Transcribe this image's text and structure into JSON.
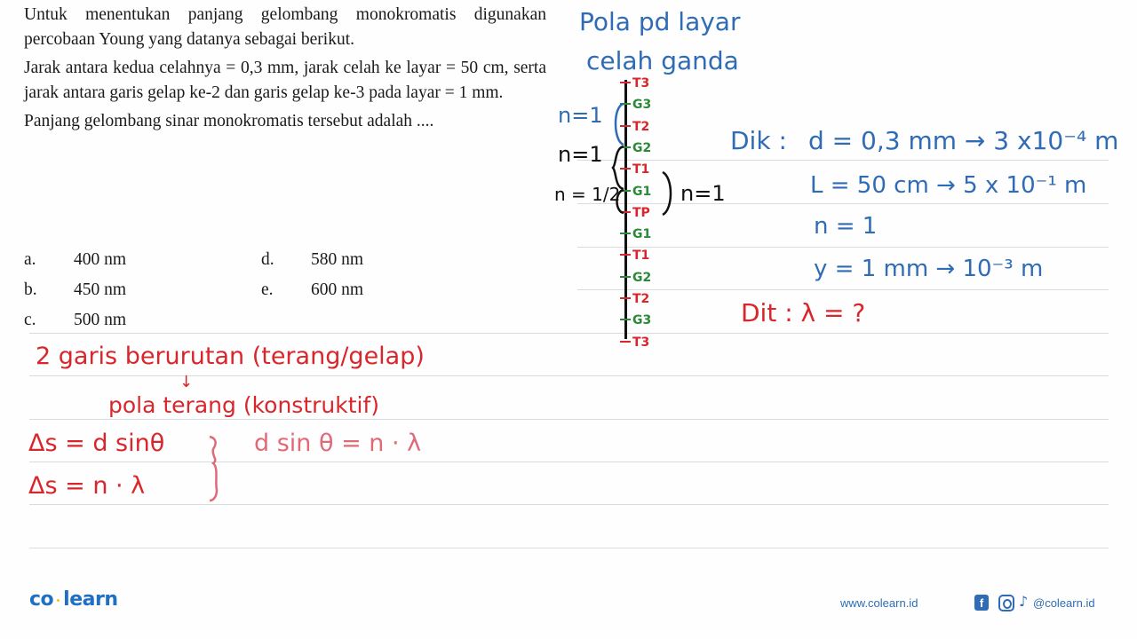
{
  "question": {
    "paragraph1": "Untuk menentukan panjang gelombang monokromatis digunakan percobaan Young yang datanya sebagai berikut.",
    "paragraph2": "Jarak antara kedua celahnya = 0,3 mm, jarak celah ke layar = 50 cm, serta jarak antara garis gelap ke-2 dan garis gelap ke-3 pada layar = 1 mm.",
    "paragraph3": "Panjang gelombang sinar monokromatis tersebut adalah ....",
    "options": [
      {
        "letter": "a.",
        "value": "400 nm"
      },
      {
        "letter": "b.",
        "value": "450 nm"
      },
      {
        "letter": "c.",
        "value": "500 nm"
      },
      {
        "letter": "d.",
        "value": "580 nm"
      },
      {
        "letter": "e.",
        "value": "600 nm"
      }
    ]
  },
  "notes": {
    "diagram_title_line1": "Pola pd layar",
    "diagram_title_line2": "celah ganda",
    "pattern_marks": [
      {
        "label": "T3",
        "type": "terang"
      },
      {
        "label": "G3",
        "type": "gelap"
      },
      {
        "label": "T2",
        "type": "terang"
      },
      {
        "label": "G2",
        "type": "gelap"
      },
      {
        "label": "T1",
        "type": "terang"
      },
      {
        "label": "G1",
        "type": "gelap"
      },
      {
        "label": "TP",
        "type": "terang"
      },
      {
        "label": "G1",
        "type": "gelap"
      },
      {
        "label": "T1",
        "type": "terang"
      },
      {
        "label": "G2",
        "type": "gelap"
      },
      {
        "label": "T2",
        "type": "terang"
      },
      {
        "label": "G3",
        "type": "gelap"
      },
      {
        "label": "T3",
        "type": "terang"
      }
    ],
    "bracket_labels": {
      "g3_g2": "n=1",
      "g2_g1": "n=1",
      "g1_tp": "n = 1/2",
      "t1_tp": "n=1"
    },
    "known_label": "Dik :",
    "known": [
      "d = 0,3 mm → 3 x10⁻⁴ m",
      "L = 50 cm → 5 x 10⁻¹ m",
      "n = 1",
      "y = 1 mm → 10⁻³ m"
    ],
    "asked": "Dit : λ = ?",
    "consecutive_lines": "2 garis berurutan (terang/gelap)",
    "arrow": "↓",
    "bright_pattern": "pola terang (konstruktif)",
    "eq1": "Δs = d sinθ",
    "eq2": "Δs = n · λ",
    "eq_combined": "d sin θ = n · λ"
  },
  "footer": {
    "brand_left": "co",
    "brand_right": "learn",
    "website": "www.colearn.id",
    "facebook_glyph": "f",
    "tiktok_glyph": "♪",
    "handle": "@colearn.id"
  },
  "colors": {
    "blue_ink": "#2f6cb5",
    "red_ink": "#d9262c",
    "green_ink": "#2a8a3a",
    "brand": "#1f6fc4"
  }
}
